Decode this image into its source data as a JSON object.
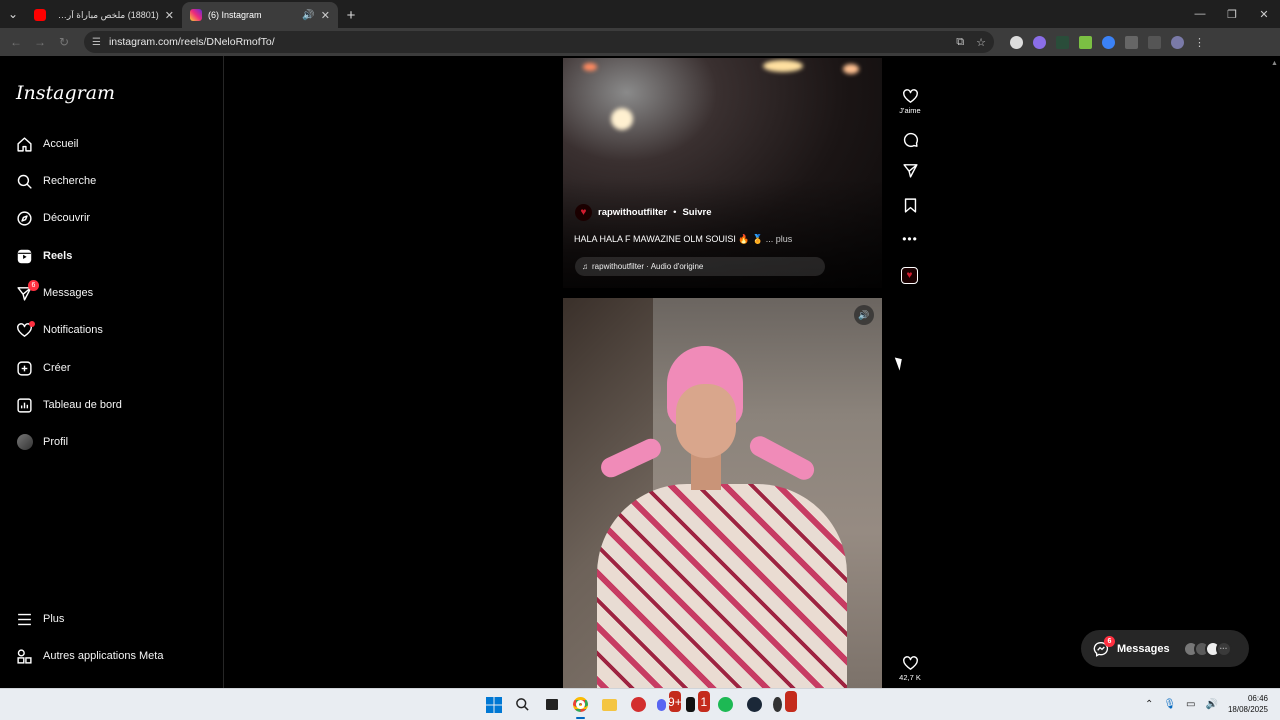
{
  "browser": {
    "tabs": [
      {
        "title": "(18801) ملخص مباراة آرسنال ور...",
        "active": false,
        "favicon_color": "#ff0000"
      },
      {
        "title": "(6) Instagram",
        "active": true,
        "favicon_color": "#e1306c"
      }
    ],
    "url": "instagram.com/reels/DNeloRmofTo/"
  },
  "instagram": {
    "logo": "Instagram",
    "nav": [
      {
        "label": "Accueil",
        "icon": "home-icon"
      },
      {
        "label": "Recherche",
        "icon": "search-icon"
      },
      {
        "label": "Découvrir",
        "icon": "compass-icon"
      },
      {
        "label": "Reels",
        "icon": "reels-icon"
      },
      {
        "label": "Messages",
        "icon": "send-icon",
        "badge": "6"
      },
      {
        "label": "Notifications",
        "icon": "heart-icon"
      },
      {
        "label": "Créer",
        "icon": "plus-icon"
      },
      {
        "label": "Tableau de bord",
        "icon": "dashboard-icon"
      },
      {
        "label": "Profil",
        "icon": "avatar"
      },
      {
        "label": "Plus",
        "icon": "menu-icon"
      },
      {
        "label": "Autres applications Meta",
        "icon": "meta-apps-icon"
      }
    ],
    "reel1": {
      "author": "rapwithoutfilter",
      "separator": "•",
      "follow": "Suivre",
      "caption": "HALA HALA F MAWAZINE OLM SOUISI 🔥 🏅",
      "more": "... plus",
      "audio": "rapwithoutfilter · Audio d'origine",
      "like_label": "J'aime"
    },
    "reel2": {
      "likes": "42,7 K"
    },
    "messages_float": {
      "label": "Messages",
      "badge": "6"
    }
  },
  "taskbar": {
    "time": "06:46",
    "date": "18/08/2025",
    "badge_discord": "9+",
    "badge_capcut": "1"
  }
}
